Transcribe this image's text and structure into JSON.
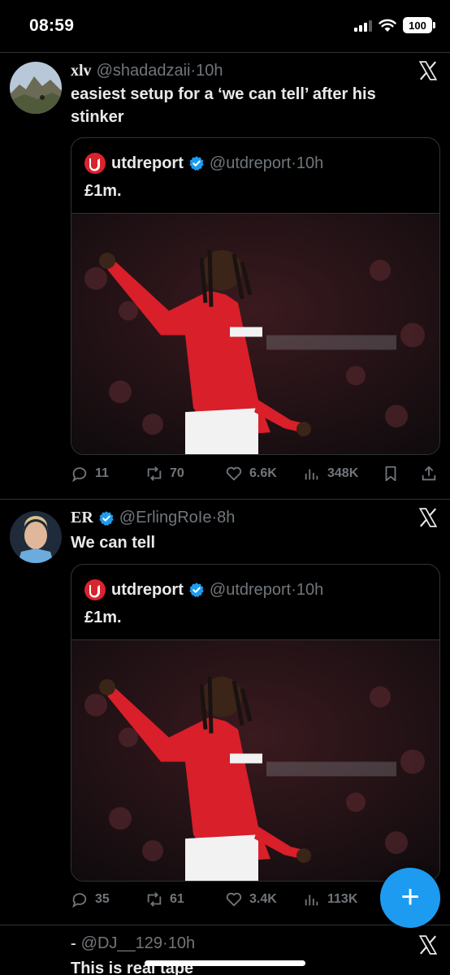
{
  "status_bar": {
    "time": "08:59",
    "battery": "100"
  },
  "tweets": [
    {
      "name": "xlv",
      "handle": "@shadadzaii",
      "separator": "·",
      "time": "10h",
      "text": "easiest setup for a ‘we can tell’ after his stinker",
      "quote": {
        "name": "utdreport",
        "handle": "@utdreport",
        "separator": "·",
        "time": "10h",
        "text": "£1m."
      },
      "actions": {
        "replies": "11",
        "reposts": "70",
        "likes": "6.6K",
        "views": "348K"
      }
    },
    {
      "name": "ER",
      "handle": "@ErlingRoIe",
      "separator": "·",
      "time": "8h",
      "text": "We can tell",
      "quote": {
        "name": "utdreport",
        "handle": "@utdreport",
        "separator": "·",
        "time": "10h",
        "text": "£1m."
      },
      "actions": {
        "replies": "35",
        "reposts": "61",
        "likes": "3.4K",
        "views": "113K"
      }
    },
    {
      "name": "-",
      "handle": "@DJ__129",
      "separator": "·",
      "time": "10h",
      "text": "This is real tape"
    }
  ],
  "fab": {
    "icon": "plus-icon",
    "color": "#1d9bf0"
  },
  "colors": {
    "accent": "#1d9bf0",
    "muted": "#71767b",
    "divider": "#2f3336"
  }
}
